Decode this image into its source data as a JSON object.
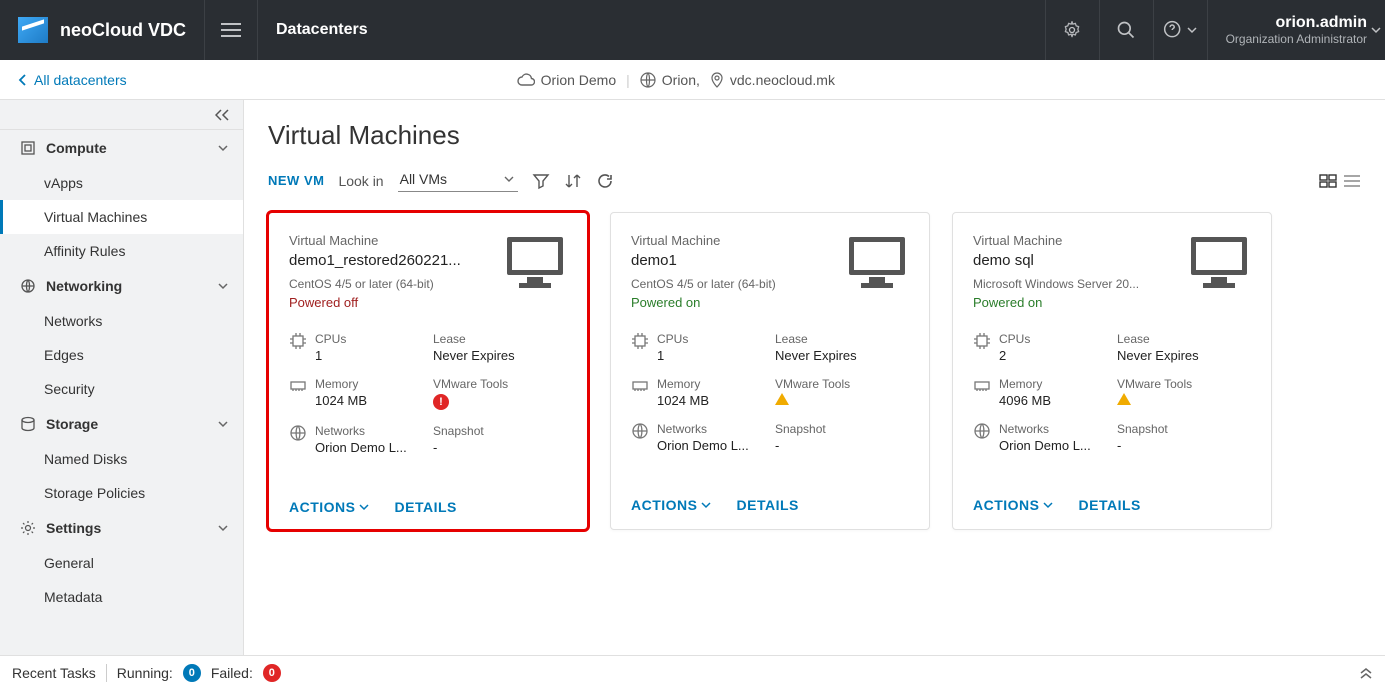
{
  "header": {
    "brand": "neoCloud VDC",
    "section": "Datacenters",
    "user_name": "orion.admin",
    "user_role": "Organization Administrator"
  },
  "breadcrumb": {
    "back": "All datacenters",
    "org": "Orion Demo",
    "site": "Orion,",
    "host": "vdc.neocloud.mk"
  },
  "sidebar": {
    "groups": [
      {
        "label": "Compute",
        "items": [
          "vApps",
          "Virtual Machines",
          "Affinity Rules"
        ],
        "active_index": 1
      },
      {
        "label": "Networking",
        "items": [
          "Networks",
          "Edges",
          "Security"
        ]
      },
      {
        "label": "Storage",
        "items": [
          "Named Disks",
          "Storage Policies"
        ]
      },
      {
        "label": "Settings",
        "items": [
          "General",
          "Metadata"
        ]
      }
    ]
  },
  "page": {
    "title": "Virtual Machines",
    "new_vm": "NEW VM",
    "lookin_label": "Look in",
    "lookin_value": "All VMs"
  },
  "labels": {
    "vm_card": "Virtual Machine",
    "cpus": "CPUs",
    "memory": "Memory",
    "networks": "Networks",
    "lease": "Lease",
    "vmware_tools": "VMware Tools",
    "snapshot": "Snapshot",
    "actions": "ACTIONS",
    "details": "DETAILS"
  },
  "vms": [
    {
      "name": "demo1_restored260221...",
      "os": "CentOS 4/5 or later (64-bit)",
      "status": "Powered off",
      "status_class": "off",
      "cpus": "1",
      "memory": "1024 MB",
      "networks": "Orion Demo L...",
      "lease": "Never Expires",
      "tools_badge": "err",
      "snapshot": "-",
      "highlighted": true
    },
    {
      "name": "demo1",
      "os": "CentOS 4/5 or later (64-bit)",
      "status": "Powered on",
      "status_class": "on",
      "cpus": "1",
      "memory": "1024 MB",
      "networks": "Orion Demo L...",
      "lease": "Never Expires",
      "tools_badge": "warn",
      "snapshot": "-",
      "highlighted": false
    },
    {
      "name": "demo sql",
      "os": "Microsoft Windows Server 20...",
      "status": "Powered on",
      "status_class": "on",
      "cpus": "2",
      "memory": "4096 MB",
      "networks": "Orion Demo L...",
      "lease": "Never Expires",
      "tools_badge": "warn",
      "snapshot": "-",
      "highlighted": false
    }
  ],
  "footer": {
    "recent": "Recent Tasks",
    "running_label": "Running:",
    "running_count": "0",
    "failed_label": "Failed:",
    "failed_count": "0"
  }
}
